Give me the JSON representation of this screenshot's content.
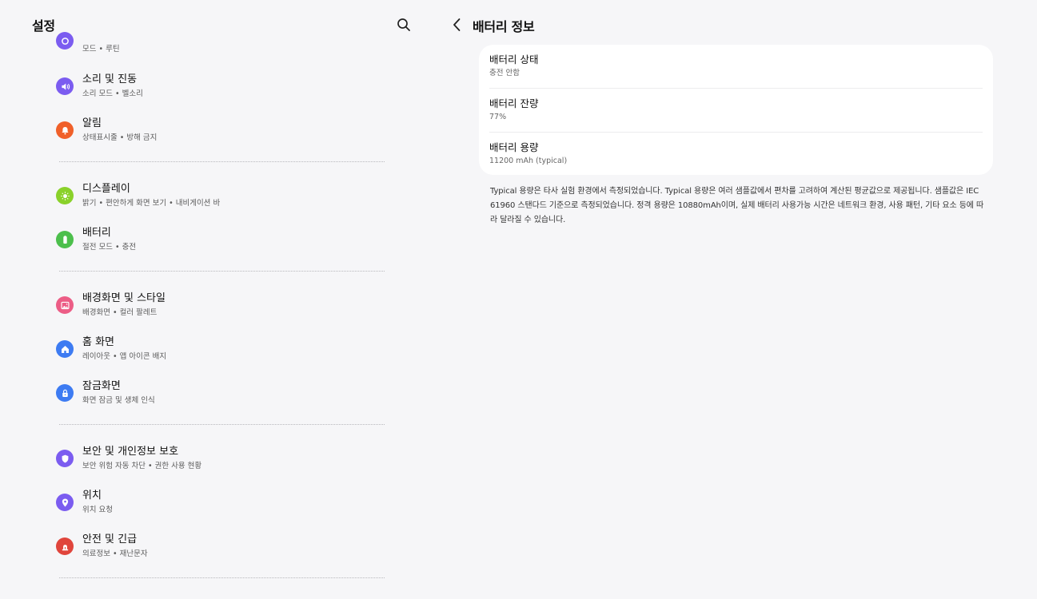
{
  "left": {
    "title": "설정",
    "search_icon": "search-icon",
    "items": [
      {
        "name": "modes-routines",
        "title": "",
        "subtitle": "모드 • 루틴",
        "icon": "modes-icon",
        "color": "#7b5cf0"
      },
      {
        "name": "sound-vibration",
        "title": "소리 및 진동",
        "subtitle": "소리 모드 • 벨소리",
        "icon": "speaker-icon",
        "color": "#7b5cf0"
      },
      {
        "name": "notifications",
        "title": "알림",
        "subtitle": "상태표시줄 • 방해 금지",
        "icon": "bell-icon",
        "color": "#f0602a"
      },
      {
        "name": "display",
        "title": "디스플레이",
        "subtitle": "밝기 • 편안하게 화면 보기 • 내비게이션 바",
        "icon": "sun-icon",
        "color": "#8ad12a"
      },
      {
        "name": "battery",
        "title": "배터리",
        "subtitle": "절전 모드 • 충전",
        "icon": "battery-icon",
        "color": "#4cbf4c"
      },
      {
        "name": "wallpaper-style",
        "title": "배경화면 및 스타일",
        "subtitle": "배경화면 • 컬러 팔레트",
        "icon": "image-icon",
        "color": "#ec5d86"
      },
      {
        "name": "home-screen",
        "title": "홈 화면",
        "subtitle": "레이아웃 • 앱 아이콘 배지",
        "icon": "home-icon",
        "color": "#3d7bf2"
      },
      {
        "name": "lock-screen",
        "title": "잠금화면",
        "subtitle": "화면 잠금 및 생체 인식",
        "icon": "lock-icon",
        "color": "#3d7bf2"
      },
      {
        "name": "security-privacy",
        "title": "보안 및 개인정보 보호",
        "subtitle": "보안 위험 자동 차단 • 권한 사용 현황",
        "icon": "shield-icon",
        "color": "#7b5cf0"
      },
      {
        "name": "location",
        "title": "위치",
        "subtitle": "위치 요청",
        "icon": "location-pin-icon",
        "color": "#7b5cf0"
      },
      {
        "name": "safety-emergency",
        "title": "안전 및 긴급",
        "subtitle": "의료정보 • 재난문자",
        "icon": "siren-icon",
        "color": "#e0453c"
      }
    ]
  },
  "right": {
    "title": "배터리 정보",
    "back_icon": "back-arrow-icon",
    "rows": [
      {
        "title": "배터리 상태",
        "value": "충전 안함"
      },
      {
        "title": "배터리 잔량",
        "value": "77%"
      },
      {
        "title": "배터리 용량",
        "value": "11200 mAh (typical)"
      }
    ],
    "description": "Typical 용량은 타사 실험 환경에서 측정되었습니다. Typical 용량은 여러 샘플값에서 편차를 고려하여 계산된 평균값으로 제공됩니다. 샘플값은 IEC 61960 스탠다드 기준으로 측정되었습니다. 정격 용량은 10880mAh이며, 실제 배터리 사용가능 시간은 네트워크 환경, 사용 패턴, 기타 요소 등에 따라 달라질 수 있습니다."
  }
}
